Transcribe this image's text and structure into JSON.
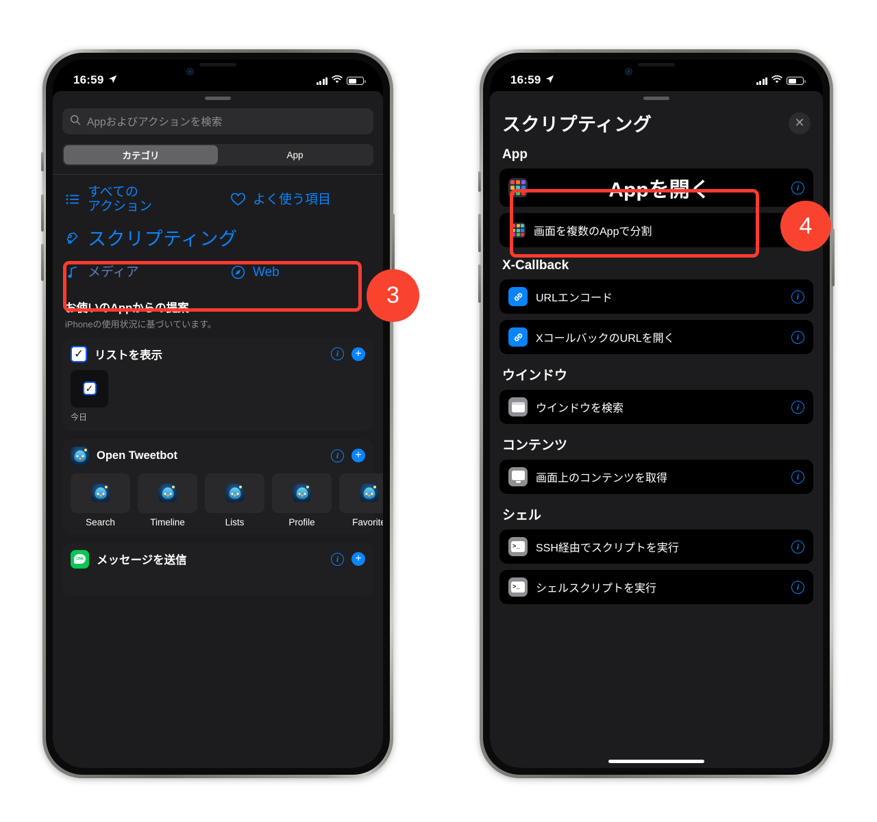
{
  "status_bar": {
    "time": "16:59",
    "location_icon": "location-arrow-icon",
    "signal_icon": "cellular-signal-icon",
    "wifi_icon": "wifi-icon",
    "battery_icon": "battery-icon"
  },
  "left_phone": {
    "search": {
      "placeholder": "Appおよびアクションを検索",
      "value": "",
      "icon": "search-icon"
    },
    "segments": [
      {
        "label": "カテゴリ",
        "selected": true
      },
      {
        "label": "App",
        "selected": false
      }
    ],
    "categories": [
      {
        "label": "すべての\nアクション",
        "label_line1": "すべての",
        "label_line2": "アクション",
        "icon": "list-bullet-icon"
      },
      {
        "label": "よく使う項目",
        "icon": "heart-icon"
      },
      {
        "label": "スクリプティング",
        "icon": "scripting-icon",
        "highlighted": true
      },
      {
        "label": "メディア",
        "icon": "music-note-icon"
      },
      {
        "label": "Web",
        "icon": "compass-icon"
      }
    ],
    "suggestions": {
      "title": "お使いのAppからの提案",
      "subtitle": "iPhoneの使用状況に基づいています。",
      "cards": [
        {
          "label": "リストを表示",
          "icon": "checkbox-checked-icon",
          "info_icon": "info-icon",
          "add_icon": "plus-icon",
          "preview_caption": "今日",
          "preview_icon": "checkbox-checked-icon"
        },
        {
          "label": "Open Tweetbot",
          "icon": "tweetbot-app-icon",
          "info_icon": "info-icon",
          "add_icon": "plus-icon",
          "tiles": [
            {
              "caption": "Search",
              "icon": "tweetbot-app-icon"
            },
            {
              "caption": "Timeline",
              "icon": "tweetbot-app-icon"
            },
            {
              "caption": "Lists",
              "icon": "tweetbot-app-icon"
            },
            {
              "caption": "Profile",
              "icon": "tweetbot-app-icon"
            },
            {
              "caption": "Favorite",
              "icon": "tweetbot-app-icon"
            }
          ]
        },
        {
          "label": "メッセージを送信",
          "icon": "line-app-icon",
          "info_icon": "info-icon",
          "add_icon": "plus-icon"
        }
      ]
    }
  },
  "right_phone": {
    "title": "スクリプティング",
    "close_icon": "close-icon",
    "groups": [
      {
        "title": "App",
        "rows": [
          {
            "label": "Appを開く",
            "icon": "app-grid-icon",
            "info_icon": "info-icon",
            "highlighted": true
          },
          {
            "label": "画面を複数のAppで分割",
            "icon": "app-grid-small-icon",
            "info_icon": "info-icon"
          }
        ]
      },
      {
        "title": "X-Callback",
        "rows": [
          {
            "label": "URLエンコード",
            "icon": "link-icon",
            "info_icon": "info-icon"
          },
          {
            "label": "XコールバックのURLを開く",
            "icon": "link-icon",
            "info_icon": "info-icon"
          }
        ]
      },
      {
        "title": "ウインドウ",
        "rows": [
          {
            "label": "ウインドウを検索",
            "icon": "window-icon",
            "info_icon": "info-icon"
          }
        ]
      },
      {
        "title": "コンテンツ",
        "rows": [
          {
            "label": "画面上のコンテンツを取得",
            "icon": "monitor-icon",
            "info_icon": "info-icon"
          }
        ]
      },
      {
        "title": "シェル",
        "rows": [
          {
            "label": "SSH経由でスクリプトを実行",
            "icon": "terminal-icon",
            "info_icon": "info-icon"
          },
          {
            "label": "シェルスクリプトを実行",
            "icon": "terminal-icon",
            "info_icon": "info-icon"
          }
        ]
      }
    ]
  },
  "annotations": {
    "step3": "3",
    "step4": "4",
    "highlight_color": "#ff3b30",
    "badge_color": "#f9432f"
  },
  "colors": {
    "accent_blue": "#0a84ff",
    "sheet_bg": "#1c1c1e",
    "row_bg": "#000000",
    "secondary_text": "#8e8e93"
  }
}
